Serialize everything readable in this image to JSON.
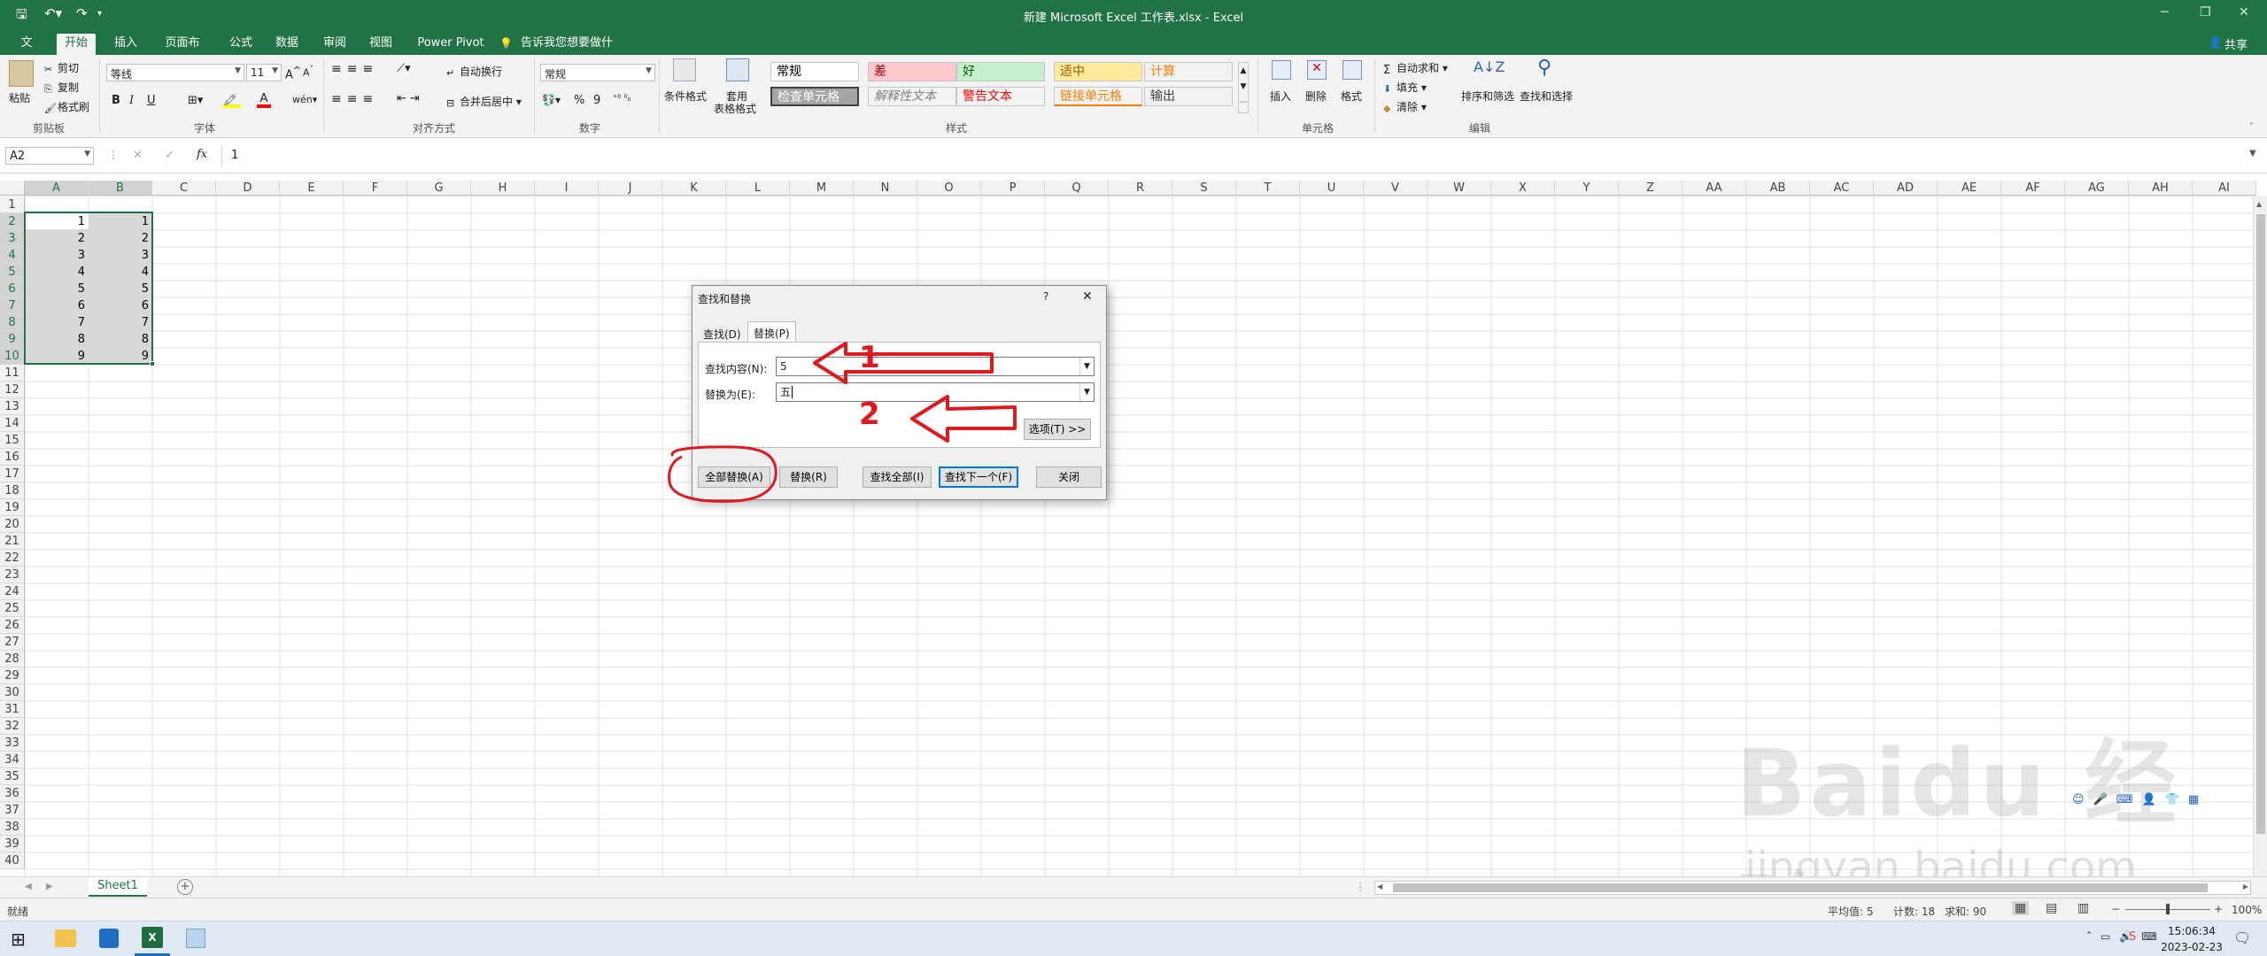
{
  "titlebar": {
    "title": "新建 Microsoft Excel 工作表.xlsx - Excel",
    "share": "共享"
  },
  "tabs": [
    {
      "label": "文件"
    },
    {
      "label": "开始"
    },
    {
      "label": "插入"
    },
    {
      "label": "页面布局"
    },
    {
      "label": "公式"
    },
    {
      "label": "数据"
    },
    {
      "label": "审阅"
    },
    {
      "label": "视图"
    },
    {
      "label": "Power Pivot"
    }
  ],
  "tellme": "告诉我您想要做什么...",
  "ribbon": {
    "clipboard": {
      "group": "剪贴板",
      "paste": "粘贴",
      "cut": "剪切",
      "copy": "复制",
      "format_painter": "格式刷"
    },
    "font": {
      "group": "字体",
      "name": "等线",
      "size": "11",
      "bold": "B",
      "italic": "I",
      "underline": "U"
    },
    "alignment": {
      "group": "对齐方式",
      "wrap": "自动换行",
      "merge": "合并后居中"
    },
    "number": {
      "group": "数字",
      "format": "常规",
      "percent": "%",
      "comma": "9"
    },
    "styles": {
      "group": "样式",
      "conditional": "条件格式",
      "table_format_1": "套用",
      "table_format_2": "表格格式",
      "cells": [
        {
          "label": "常规",
          "bg": "#ffffff",
          "fg": "#000000"
        },
        {
          "label": "差",
          "bg": "#ffc7ce",
          "fg": "#9c0006"
        },
        {
          "label": "好",
          "bg": "#c6efce",
          "fg": "#006100"
        },
        {
          "label": "适中",
          "bg": "#ffeb9c",
          "fg": "#9c5700"
        },
        {
          "label": "计算",
          "bg": "#f2f2f2",
          "fg": "#fa7d00"
        },
        {
          "label": "检查单元格",
          "bg": "#a5a5a5",
          "fg": "#ffffff"
        },
        {
          "label": "解释性文本",
          "bg": "#f3f3f3",
          "fg": "#7f7f7f"
        },
        {
          "label": "警告文本",
          "bg": "#f3f3f3",
          "fg": "#ff0000"
        },
        {
          "label": "链接单元格",
          "bg": "#f3f3f3",
          "fg": "#fa7d00"
        },
        {
          "label": "输出",
          "bg": "#f2f2f2",
          "fg": "#3f3f3f"
        }
      ]
    },
    "cells_group": {
      "group": "单元格",
      "insert": "插入",
      "delete": "删除",
      "format": "格式"
    },
    "editing": {
      "group": "编辑",
      "autosum": "自动求和",
      "fill": "填充",
      "clear": "清除",
      "sort": "排序和筛选",
      "find": "查找和选择"
    }
  },
  "formula_bar": {
    "namebox": "A2",
    "fx": "fx",
    "content": "1"
  },
  "columns": [
    "A",
    "B",
    "C",
    "D",
    "E",
    "F",
    "G",
    "H",
    "I",
    "J",
    "K",
    "L",
    "M",
    "N",
    "O",
    "P",
    "Q",
    "R",
    "S",
    "T",
    "U",
    "V",
    "W",
    "X",
    "Y",
    "Z",
    "AA",
    "AB",
    "AC",
    "AD",
    "AE",
    "AF",
    "AG",
    "AH",
    "AI"
  ],
  "rows": [
    "1",
    "2",
    "3",
    "4",
    "5",
    "6",
    "7",
    "8",
    "9",
    "10",
    "11",
    "12",
    "13",
    "14",
    "15",
    "16",
    "17",
    "18",
    "19",
    "20",
    "21",
    "22",
    "23",
    "24",
    "25",
    "26",
    "27",
    "28",
    "29",
    "30",
    "31",
    "32",
    "33",
    "34",
    "35",
    "36",
    "37",
    "38",
    "39",
    "40"
  ],
  "cells": {
    "A": [
      "1",
      "2",
      "3",
      "4",
      "5",
      "6",
      "7",
      "8",
      "9"
    ],
    "B": [
      "1",
      "2",
      "3",
      "4",
      "5",
      "6",
      "7",
      "8",
      "9"
    ]
  },
  "dialog": {
    "title": "查找和替换",
    "help": "?",
    "close": "✕",
    "tab_find": "查找(D)",
    "tab_replace": "替换(P)",
    "find_label": "查找内容(N):",
    "find_value": "5",
    "replace_label": "替换为(E):",
    "replace_value": "五",
    "options": "选项(T) >>",
    "replace_all": "全部替换(A)",
    "replace": "替换(R)",
    "find_all": "查找全部(I)",
    "find_next": "查找下一个(F)",
    "close_btn": "关闭"
  },
  "annotations": {
    "num1": "1",
    "num2": "2",
    "color": "#e0191f"
  },
  "sheet": {
    "tab": "Sheet1",
    "add": "+"
  },
  "status": {
    "ready": "就绪",
    "average": "平均值: 5",
    "count": "计数: 18",
    "sum": "求和: 90",
    "zoom": "100%"
  },
  "taskbar": {
    "time": "15:06:34",
    "date": "2023-02-23"
  },
  "watermark": {
    "brand": "Baidu 经验",
    "url": "jingyan.baidu.com"
  }
}
